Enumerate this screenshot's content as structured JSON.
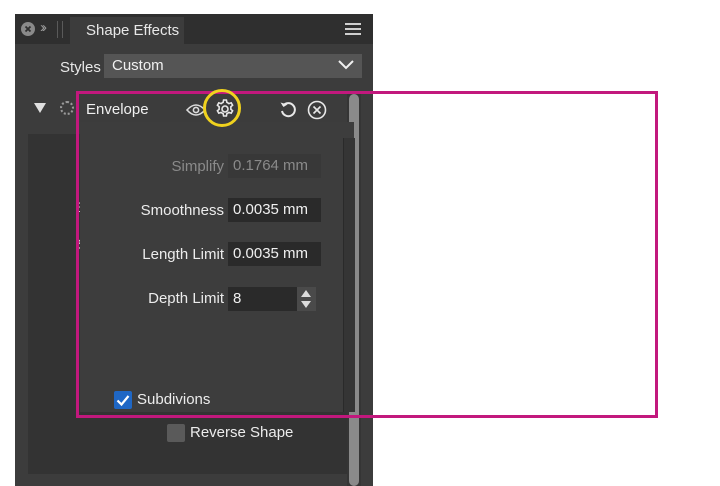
{
  "window": {
    "tab_title": "Shape Effects"
  },
  "styles": {
    "label": "Styles",
    "value": "Custom"
  },
  "effect": {
    "name": "Envelope"
  },
  "fields": {
    "simplify": {
      "label": "Simplify",
      "value": "0.1764 mm"
    },
    "smoothness": {
      "label": "Smoothness",
      "value": "0.0035 mm"
    },
    "length_limit": {
      "label": "Length Limit",
      "value": "0.0035 mm"
    },
    "depth_limit": {
      "label": "Depth Limit",
      "value": "8"
    }
  },
  "checkboxes": {
    "subdivisions": {
      "label": "Subdivions",
      "checked": true
    },
    "reverse_shape": {
      "label": "Reverse Shape",
      "checked": false
    }
  },
  "background_fragments": {
    "a": "E",
    "b": "S"
  },
  "colors": {
    "annotation_rect": "#c2187d",
    "annotation_circle": "#f0d21e",
    "checkbox_accent": "#1f67c5"
  },
  "icons": [
    "close-icon",
    "expand-chevrons-icon",
    "hamburger-menu-icon",
    "chevron-down-icon",
    "disclosure-triangle-icon",
    "effect-icon",
    "eye-icon",
    "gear-icon",
    "reset-icon",
    "remove-icon",
    "stepper-up-icon",
    "stepper-down-icon",
    "checkmark-icon"
  ]
}
